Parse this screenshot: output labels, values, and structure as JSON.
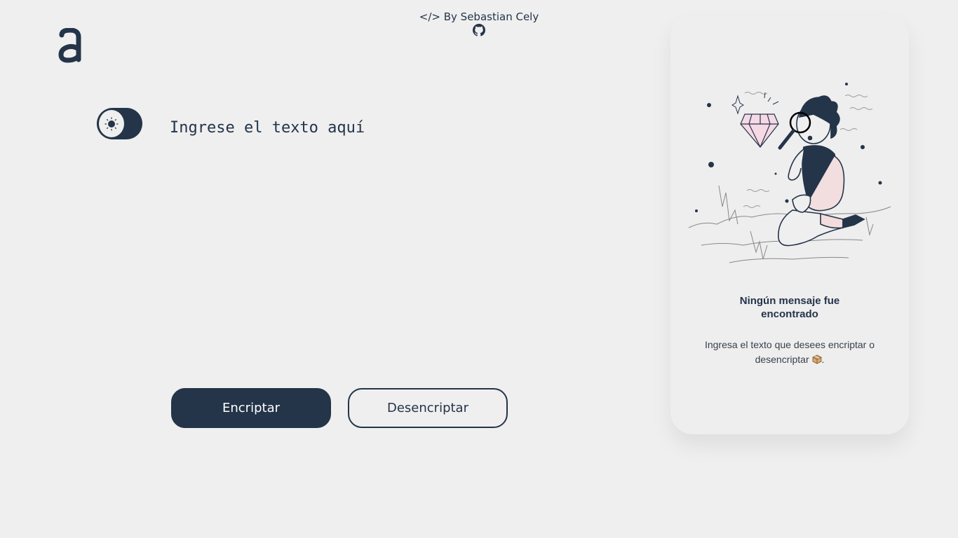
{
  "header": {
    "credit_text": "</> By Sebastian Cely"
  },
  "icons": {
    "logo": "alura-a-logo",
    "github": "github-icon",
    "theme": "sun-icon",
    "package": "package-icon"
  },
  "editor": {
    "placeholder": "Ingrese el texto aquí",
    "value": ""
  },
  "actions": {
    "encrypt_label": "Encriptar",
    "decrypt_label": "Desencriptar"
  },
  "result": {
    "title": "Ningún mensaje fue encontrado",
    "description": "Ingresa el texto que desees encriptar o desencriptar",
    "description_end": "."
  },
  "colors": {
    "primary": "#243449",
    "background": "#efefef",
    "card": "#eeeeee"
  }
}
